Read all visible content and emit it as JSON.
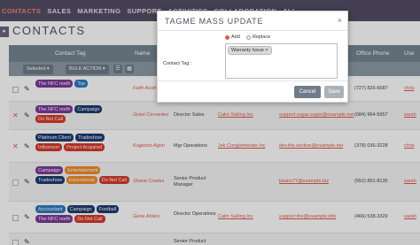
{
  "nav": {
    "items": [
      "CONTACTS",
      "SALES",
      "MARKETING",
      "SUPPORT",
      "ACTIVITIES",
      "COLLABORATION",
      "ALL"
    ]
  },
  "page": {
    "title": "CONTACTS"
  },
  "table": {
    "headers": {
      "contact_tag": "Contact Tag",
      "name": "Name",
      "office_phone": "Office Phone",
      "user": "Use"
    },
    "toolbar": {
      "selected": "Selected",
      "bulk_action": "BULK ACTION"
    },
    "rows": [
      {
        "tags": [
          {
            "label": "The NFC north",
            "color": "#7b3a99"
          },
          {
            "label": "Top",
            "color": "#2b7ac0"
          }
        ],
        "name": "Faith Acott",
        "title": "",
        "account": "",
        "email": "",
        "phone": "(727) 826-6687",
        "user": "chris",
        "deleted": false
      },
      {
        "tags": [
          {
            "label": "The NFC north",
            "color": "#7b3a99"
          },
          {
            "label": "Campaign",
            "color": "#1e3c70"
          },
          {
            "label": "Do Not Call",
            "color": "#d63a2a"
          }
        ],
        "name": "Grant Cervantes",
        "title": "Director Sales",
        "account": "Calm Sailing Inc",
        "email": "support.sugar.sugar@example.net",
        "phone": "(684) 964-5957",
        "user": "sarah",
        "deleted": true
      },
      {
        "tags": [
          {
            "label": "Platinum Client",
            "color": "#1e3c70"
          },
          {
            "label": "Tradeshow",
            "color": "#1e3c70"
          },
          {
            "label": "Influencer",
            "color": "#d63a2a"
          },
          {
            "label": "Project Acquired",
            "color": "#d63a2a"
          }
        ],
        "name": "Kagenzo Agon",
        "title": "Mgr Operations",
        "account": "Jek Conglomerate Inc",
        "email": "dev.the.section@example.net",
        "phone": "(378) 036-3228",
        "user": "chris",
        "deleted": true
      },
      {
        "tags": [
          {
            "label": "Campaign",
            "color": "#7b3a99"
          },
          {
            "label": "Entertainment",
            "color": "#f08c2a"
          },
          {
            "label": "Tradeshow",
            "color": "#1e3c70"
          },
          {
            "label": "Educational",
            "color": "#f08c2a"
          },
          {
            "label": "Do Not Call",
            "color": "#d63a2a"
          }
        ],
        "name": "Shane Cowles",
        "title": "Senior Product Manager",
        "account": "",
        "email": "beans77@example.biz",
        "phone": "(552) 891-8135",
        "user": "sarah",
        "deleted": false
      },
      {
        "tags": [
          {
            "label": "Accountant",
            "color": "#2b7ac0"
          },
          {
            "label": "Campaign",
            "color": "#1e3c70"
          },
          {
            "label": "Football",
            "color": "#1e3c70"
          },
          {
            "label": "The NFC north",
            "color": "#7b3a99"
          },
          {
            "label": "Do Not Call",
            "color": "#d63a2a"
          }
        ],
        "name": "Gene Ahlers",
        "title": "Director Operations",
        "account": "Calm Sailing Inc",
        "email": "support.the@example.info",
        "phone": "(466) 538-3329",
        "user": "sarah",
        "deleted": false
      },
      {
        "tags": [],
        "name": "",
        "title": "Senior Product",
        "account": "",
        "email": "",
        "phone": "",
        "user": "",
        "deleted": false
      }
    ]
  },
  "modal": {
    "title": "TAGME MASS UPDATE",
    "close": "×",
    "option_add": "Add",
    "option_replace": "Replace",
    "field_label": "Contact Tag :",
    "chip": "Warranty Issue ×",
    "cancel": "Cancel",
    "save": "Save"
  }
}
